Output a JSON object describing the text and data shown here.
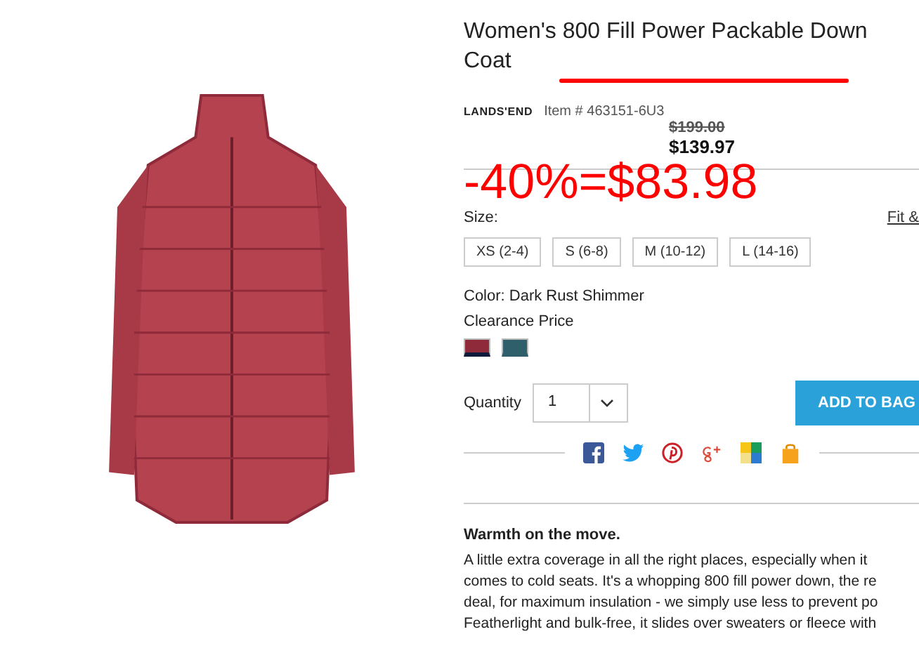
{
  "product": {
    "title": "Women's 800 Fill Power Packable Down Coat",
    "brand": "LANDS'END",
    "item_number": "Item # 463151-6U3",
    "original_price": "$199.00",
    "price": "$139.97"
  },
  "annotation": {
    "text": "-40%=$83.98"
  },
  "size": {
    "label": "Size:",
    "guide_link": "Fit &",
    "options": [
      {
        "label": "XS (2-4)",
        "selected": false
      },
      {
        "label": "S (6-8)",
        "selected": false
      },
      {
        "label": "M (10-12)",
        "selected": false
      },
      {
        "label": "L (14-16)",
        "selected": false
      }
    ]
  },
  "color": {
    "label": "Color: Dark Rust Shimmer",
    "note": "Clearance Price",
    "swatches": [
      {
        "color": "#8e2a3a",
        "selected": true
      },
      {
        "color": "#2f5f6a",
        "selected": false
      }
    ]
  },
  "quantity": {
    "label": "Quantity",
    "value": "1"
  },
  "add_button": "ADD TO BAG",
  "share": [
    {
      "kind": "facebook"
    },
    {
      "kind": "twitter"
    },
    {
      "kind": "pinterest"
    },
    {
      "kind": "googleplus"
    },
    {
      "kind": "squares"
    },
    {
      "kind": "bag"
    }
  ],
  "description": {
    "heading": "Warmth on the move.",
    "lines": [
      "A little extra coverage in all the right places, especially when it",
      "comes to cold seats. It's a whopping 800 fill power down, the re",
      "deal, for maximum insulation - we simply use less to prevent po",
      "Featherlight and bulk-free, it slides over sweaters or fleece with"
    ]
  }
}
